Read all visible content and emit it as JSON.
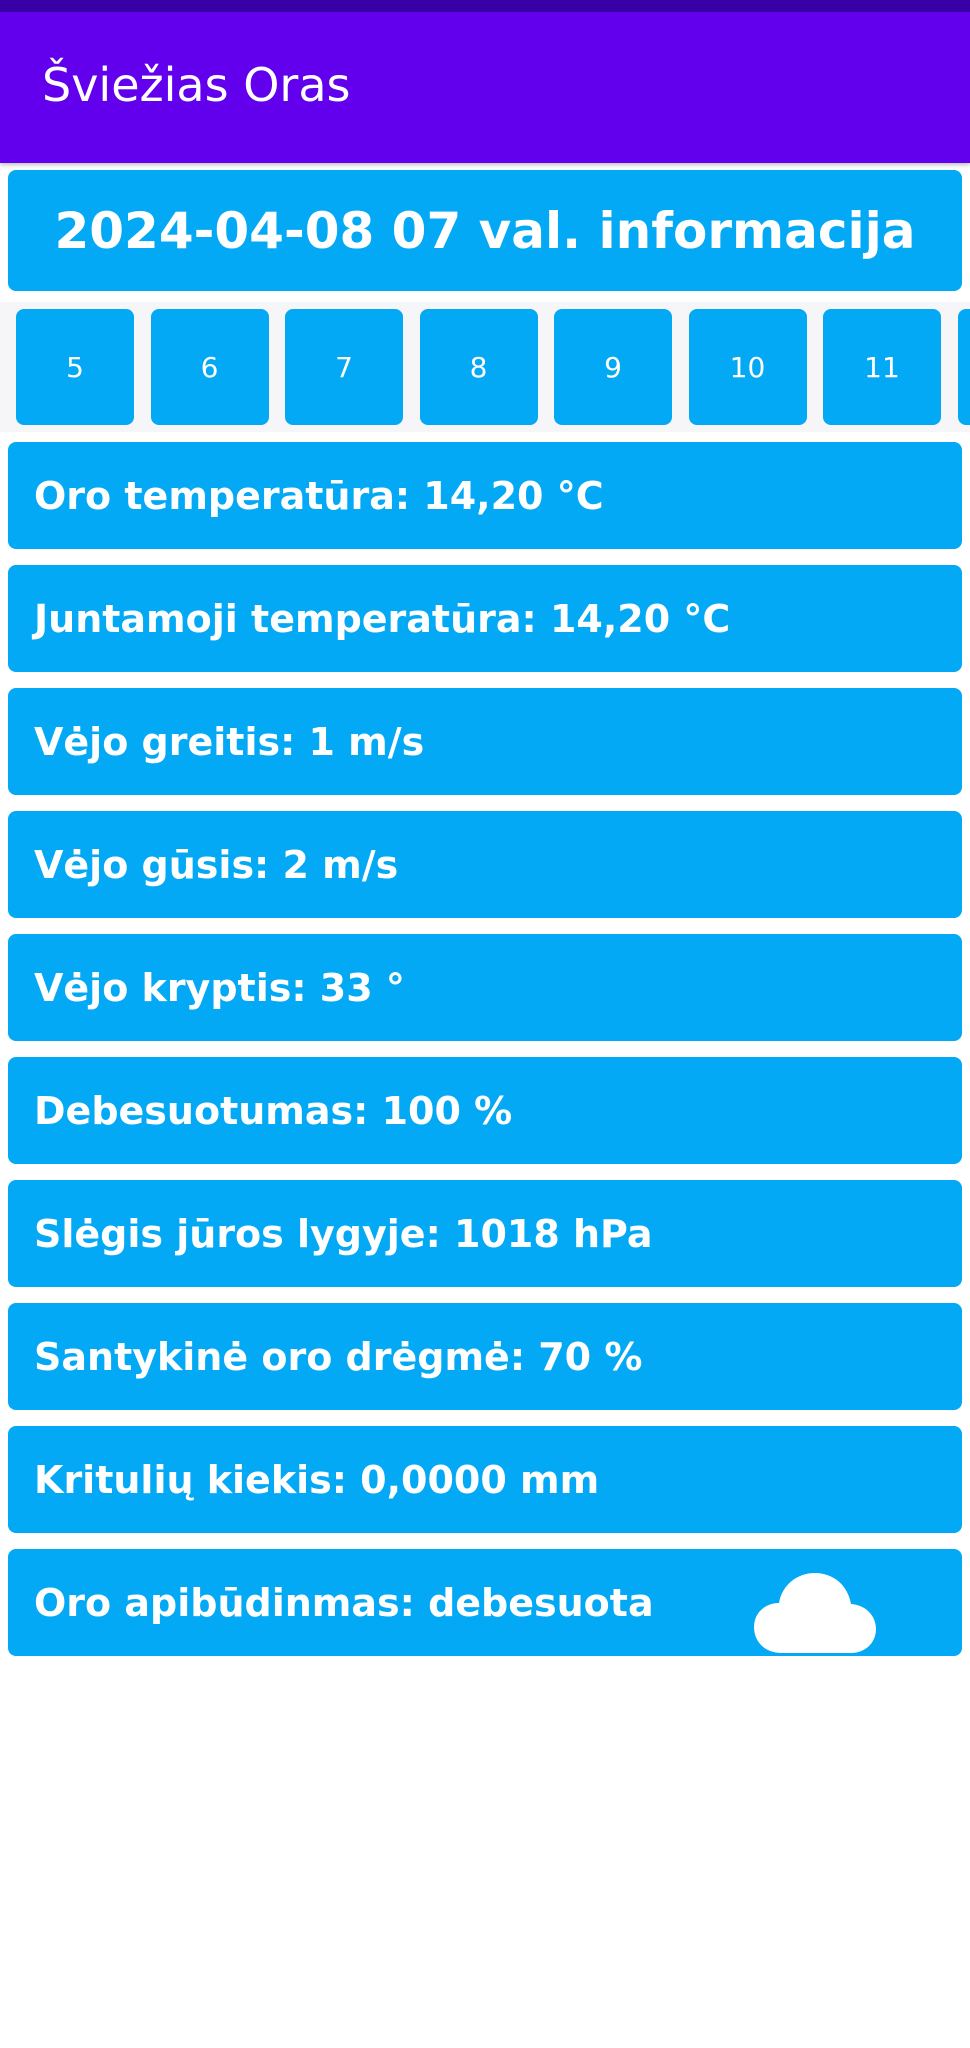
{
  "app": {
    "title": "Šviežias Oras"
  },
  "header": {
    "date_label": "2024-04-08 07 val. informacija"
  },
  "hours": [
    "5",
    "6",
    "7",
    "8",
    "9",
    "10",
    "11"
  ],
  "details": {
    "air_temp": "Oro temperatūra: 14,20 °C",
    "feels_like": "Juntamoji temperatūra: 14,20 °C",
    "wind_speed": "Vėjo greitis: 1 m/s",
    "wind_gust": "Vėjo gūsis: 2 m/s",
    "wind_direction": "Vėjo kryptis: 33 °",
    "cloudiness": "Debesuotumas: 100 %",
    "pressure": "Slėgis jūros lygyje: 1018 hPa",
    "humidity": "Santykinė oro drėgmė: 70 %",
    "precipitation": "Kritulių kiekis: 0,0000 mm",
    "condition": "Oro apibūdinmas: debesuota"
  },
  "icons": {
    "condition_icon": "cloud-icon"
  },
  "colors": {
    "app_bar": "#6200ee",
    "card": "#03a9f4",
    "text_on_card": "#ffffff"
  }
}
